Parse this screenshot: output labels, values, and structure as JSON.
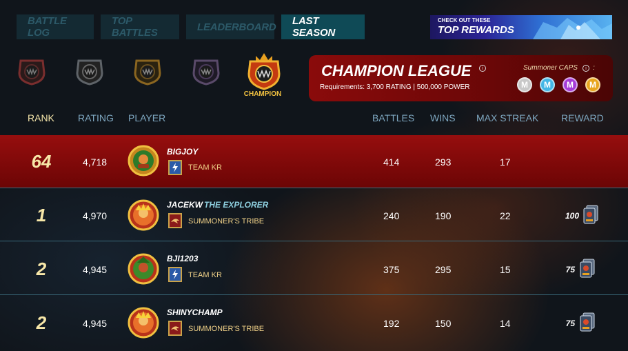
{
  "tabs": [
    {
      "label": "BATTLE LOG"
    },
    {
      "label": "TOP BATTLES"
    },
    {
      "label": "LEADERBOARD"
    },
    {
      "label": "LAST SEASON",
      "active": true
    }
  ],
  "promo": {
    "line1": "CHECK OUT THESE",
    "line2": "TOP REWARDS"
  },
  "leagues": {
    "selected_label": "CHAMPION",
    "badges": [
      "bronze-league-icon",
      "silver-league-icon",
      "gold-league-icon",
      "diamond-league-icon",
      "champion-league-icon"
    ]
  },
  "league_card": {
    "title": "CHAMPION LEAGUE",
    "requirements": "Requirements: 3,700 RATING | 500,000 POWER",
    "caps_label": "Summoner CAPS",
    "caps_suffix": ":",
    "caps": [
      {
        "letter": "M",
        "color": "#c8c8c8"
      },
      {
        "letter": "M",
        "color": "#43b6e6"
      },
      {
        "letter": "M",
        "color": "#a63bd6"
      },
      {
        "letter": "M",
        "color": "#e8a51d"
      }
    ]
  },
  "columns": {
    "rank": "RANK",
    "rating": "RATING",
    "player": "PLAYER",
    "battles": "BATTLES",
    "wins": "WINS",
    "max_streak": "MAX STREAK",
    "reward": "REWARD"
  },
  "rows": [
    {
      "rank": "64",
      "rating": "4,718",
      "player": "BIGJOY",
      "title": "",
      "guild": "TEAM KR",
      "battles": "414",
      "wins": "293",
      "max_streak": "17",
      "reward": "",
      "highlight": true
    },
    {
      "rank": "1",
      "rating": "4,970",
      "player": "JACEKW",
      "title": "THE EXPLORER",
      "guild": "SUMMONER'S TRIBE",
      "battles": "240",
      "wins": "190",
      "max_streak": "22",
      "reward": "100"
    },
    {
      "rank": "2",
      "rating": "4,945",
      "player": "BJI1203",
      "title": "",
      "guild": "TEAM KR",
      "battles": "375",
      "wins": "295",
      "max_streak": "15",
      "reward": "75"
    },
    {
      "rank": "2",
      "rating": "4,945",
      "player": "SHINYCHAMP",
      "title": "",
      "guild": "SUMMONER'S TRIBE",
      "battles": "192",
      "wins": "150",
      "max_streak": "14",
      "reward": "75"
    }
  ]
}
